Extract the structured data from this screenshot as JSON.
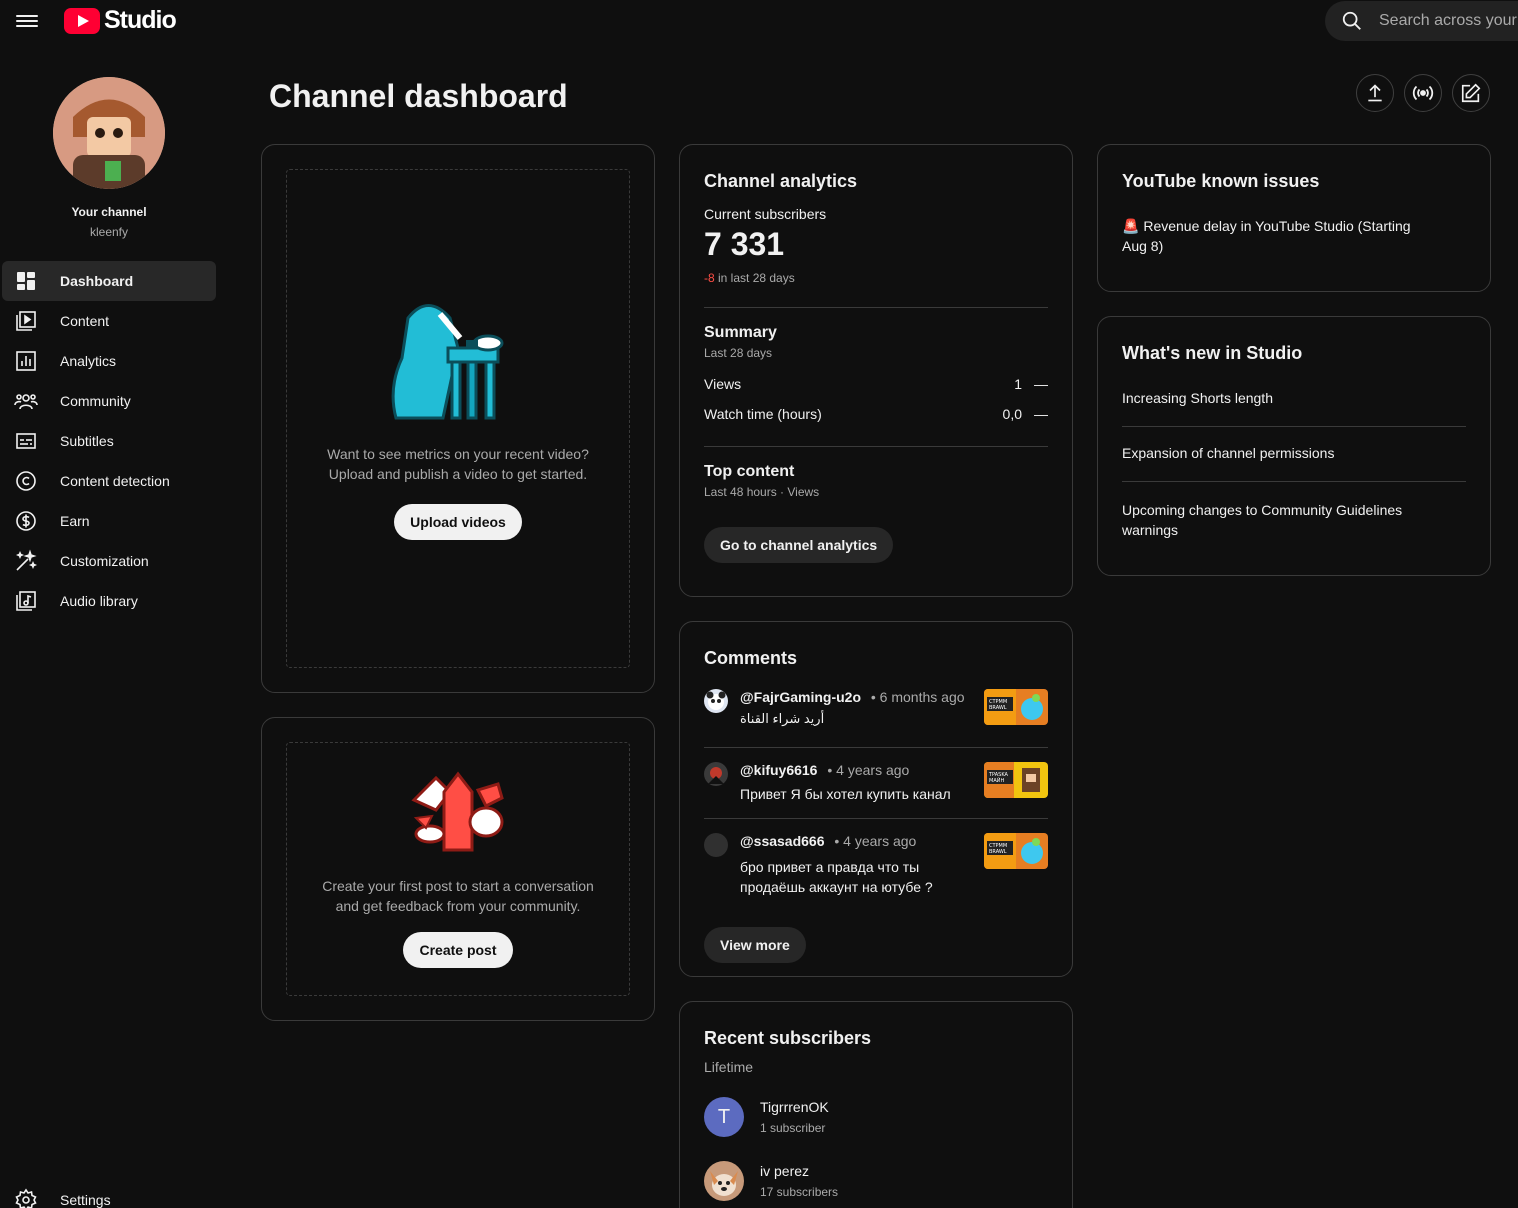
{
  "app": {
    "logo_text": "Studio"
  },
  "search": {
    "placeholder": "Search across your channel"
  },
  "channel": {
    "label": "Your channel",
    "handle": "kleenfy"
  },
  "nav": [
    {
      "label": "Dashboard",
      "icon": "dashboard-icon",
      "active": true
    },
    {
      "label": "Content",
      "icon": "content-icon"
    },
    {
      "label": "Analytics",
      "icon": "analytics-icon"
    },
    {
      "label": "Community",
      "icon": "community-icon"
    },
    {
      "label": "Subtitles",
      "icon": "subtitles-icon"
    },
    {
      "label": "Content detection",
      "icon": "copyright-icon"
    },
    {
      "label": "Earn",
      "icon": "dollar-icon"
    },
    {
      "label": "Customization",
      "icon": "magic-wand-icon"
    },
    {
      "label": "Audio library",
      "icon": "audio-library-icon"
    }
  ],
  "settings": {
    "label": "Settings"
  },
  "page": {
    "title": "Channel dashboard"
  },
  "upload_card": {
    "hint_line1": "Want to see metrics on your recent video?",
    "hint_line2": "Upload and publish a video to get started.",
    "button": "Upload videos"
  },
  "post_card": {
    "hint_line1": "Create your first post to start a conversation",
    "hint_line2": "and get feedback from your community.",
    "button": "Create post"
  },
  "analytics": {
    "title": "Channel analytics",
    "subs_label": "Current subscribers",
    "subs_value": "7 331",
    "subs_change": "-8",
    "subs_change_suffix": " in last 28 days",
    "summary_title": "Summary",
    "summary_period": "Last 28 days",
    "rows": [
      {
        "label": "Views",
        "value": "1",
        "trend": "—"
      },
      {
        "label": "Watch time (hours)",
        "value": "0,0",
        "trend": "—"
      }
    ],
    "top_title": "Top content",
    "top_period": "Last 48 hours · Views",
    "button": "Go to channel analytics"
  },
  "comments": {
    "title": "Comments",
    "items": [
      {
        "author": "@FajrGaming-u2o",
        "time": "• 6 months ago",
        "text": "أريد شراء القناة"
      },
      {
        "author": "@kifuy6616",
        "time": "• 4 years ago",
        "text": "Привет Я бы хотел купить канал"
      },
      {
        "author": "@ssasad666",
        "time": "• 4 years ago",
        "text": "бро привет а правда что ты продаёшь аккаунт на ютубе ?"
      }
    ],
    "button": "View more"
  },
  "recent_subs": {
    "title": "Recent subscribers",
    "period": "Lifetime",
    "items": [
      {
        "name": "TigrrrenOK",
        "count": "1 subscriber",
        "initial": "T"
      },
      {
        "name": "iv perez",
        "count": "17 subscribers"
      }
    ]
  },
  "known_issues": {
    "title": "YouTube known issues",
    "item": "Revenue delay in YouTube Studio (Starting Aug 8)"
  },
  "whats_new": {
    "title": "What's new in Studio",
    "items": [
      "Increasing Shorts length",
      "Expansion of channel permissions",
      "Upcoming changes to Community Guidelines warnings"
    ]
  },
  "colors": {
    "accent_red": "#ff0033",
    "negative": "#ff4e45",
    "avatar_t": "#5c6bc0"
  }
}
